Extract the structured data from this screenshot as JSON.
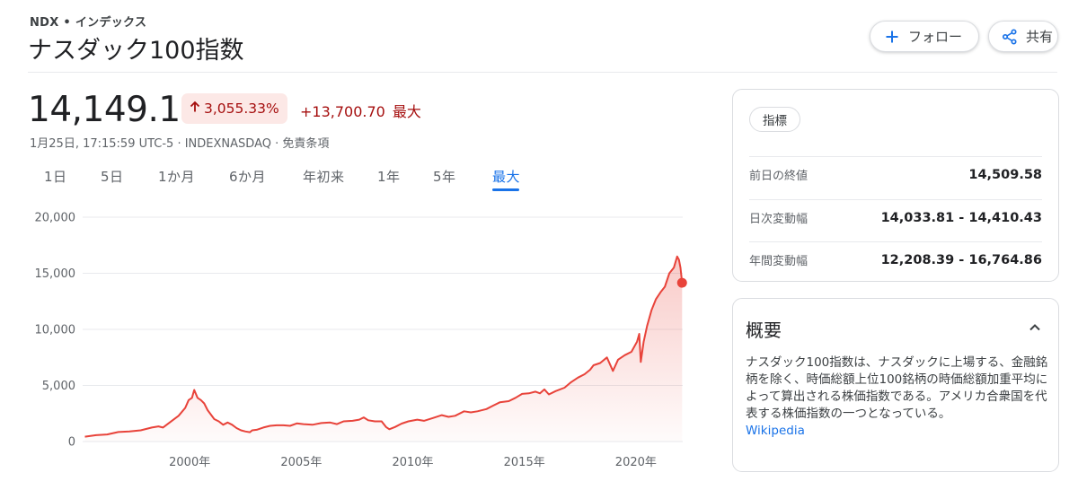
{
  "header": {
    "ticker": "NDX • インデックス",
    "title": "ナスダック100指数",
    "follow_label": "フォロー",
    "share_label": "共有"
  },
  "quote": {
    "price": "14,149.12",
    "change_pct": "3,055.33%",
    "change_abs": "+13,700.70",
    "change_period": "最大",
    "meta": "1月25日, 17:15:59 UTC-5 · INDEXNASDAQ · 免責条項"
  },
  "tabs": [
    {
      "label": "1日",
      "active": false
    },
    {
      "label": "5日",
      "active": false
    },
    {
      "label": "1か月",
      "active": false
    },
    {
      "label": "6か月",
      "active": false
    },
    {
      "label": "年初来",
      "active": false
    },
    {
      "label": "1年",
      "active": false
    },
    {
      "label": "5年",
      "active": false
    },
    {
      "label": "最大",
      "active": true
    }
  ],
  "stats": {
    "chip_label": "指標",
    "rows": [
      {
        "label": "前日の終値",
        "value": "14,509.58"
      },
      {
        "label": "日次変動幅",
        "value": "14,033.81 - 14,410.43"
      },
      {
        "label": "年間変動幅",
        "value": "12,208.39 - 16,764.86"
      }
    ]
  },
  "about": {
    "title": "概要",
    "text": "ナスダック100指数は、ナスダックに上場する、金融銘柄を除く、時価総額上位100銘柄の時価総額加重平均によって算出される株価指数である。アメリカ合衆国を代表する株価指数の一つとなっている。",
    "link": "Wikipedia"
  },
  "colors": {
    "line": "#e8433a",
    "negative": "#a50e0e",
    "accent": "#1a73e8"
  },
  "icons": [
    "plus-icon",
    "share-icon",
    "arrow-up-icon",
    "chevron-up-icon"
  ],
  "chart_data": {
    "type": "area",
    "title": "",
    "xlabel": "",
    "ylabel": "",
    "ylim": [
      0,
      20000
    ],
    "yticks": [
      "0",
      "5,000",
      "10,000",
      "15,000",
      "20,000"
    ],
    "xticks": [
      "2000年",
      "2005年",
      "2010年",
      "2015年",
      "2020年"
    ],
    "grid": true,
    "series": [
      {
        "x": [
          1995.3,
          1995.8,
          1996.3,
          1996.8,
          1997.3,
          1997.8,
          1998.3,
          1998.6,
          1998.8,
          1999.2,
          1999.5,
          1999.8,
          1999.95,
          2000.1,
          2000.2,
          2000.35,
          2000.5,
          2000.65,
          2000.8,
          2000.95,
          2001.1,
          2001.3,
          2001.5,
          2001.7,
          2001.9,
          2002.1,
          2002.3,
          2002.5,
          2002.7,
          2002.8,
          2003.0,
          2003.3,
          2003.6,
          2003.9,
          2004.2,
          2004.5,
          2004.8,
          2005.1,
          2005.5,
          2005.9,
          2006.3,
          2006.6,
          2006.9,
          2007.3,
          2007.6,
          2007.8,
          2008.0,
          2008.3,
          2008.6,
          2008.8,
          2008.95,
          2009.2,
          2009.5,
          2009.8,
          2010.2,
          2010.5,
          2010.9,
          2011.3,
          2011.6,
          2011.9,
          2012.3,
          2012.6,
          2012.9,
          2013.3,
          2013.6,
          2013.9,
          2014.3,
          2014.6,
          2014.9,
          2015.2,
          2015.5,
          2015.7,
          2015.9,
          2016.1,
          2016.4,
          2016.8,
          2017.1,
          2017.4,
          2017.7,
          2017.95,
          2018.1,
          2018.4,
          2018.7,
          2018.97,
          2019.2,
          2019.5,
          2019.8,
          2020.05,
          2020.15,
          2020.22,
          2020.35,
          2020.5,
          2020.7,
          2020.9,
          2021.1,
          2021.3,
          2021.5,
          2021.7,
          2021.85,
          2021.93,
          2022.0,
          2022.07
        ],
        "y": [
          430,
          570,
          630,
          850,
          900,
          1000,
          1250,
          1350,
          1250,
          1850,
          2300,
          3000,
          3700,
          3900,
          4600,
          3900,
          3700,
          3400,
          2800,
          2400,
          2000,
          1800,
          1500,
          1700,
          1500,
          1200,
          1000,
          900,
          830,
          1000,
          1050,
          1250,
          1400,
          1450,
          1450,
          1400,
          1620,
          1550,
          1500,
          1650,
          1700,
          1550,
          1800,
          1850,
          1950,
          2150,
          1900,
          1800,
          1800,
          1300,
          1100,
          1300,
          1600,
          1800,
          1950,
          1850,
          2100,
          2350,
          2200,
          2300,
          2700,
          2600,
          2700,
          2900,
          3200,
          3500,
          3600,
          3900,
          4250,
          4300,
          4450,
          4300,
          4650,
          4200,
          4500,
          4800,
          5300,
          5700,
          6000,
          6400,
          6800,
          7000,
          7500,
          6300,
          7300,
          7700,
          8000,
          8900,
          9600,
          7100,
          8900,
          10300,
          11700,
          12700,
          13300,
          13800,
          15000,
          15500,
          16500,
          16200,
          15500,
          14149
        ]
      }
    ]
  }
}
